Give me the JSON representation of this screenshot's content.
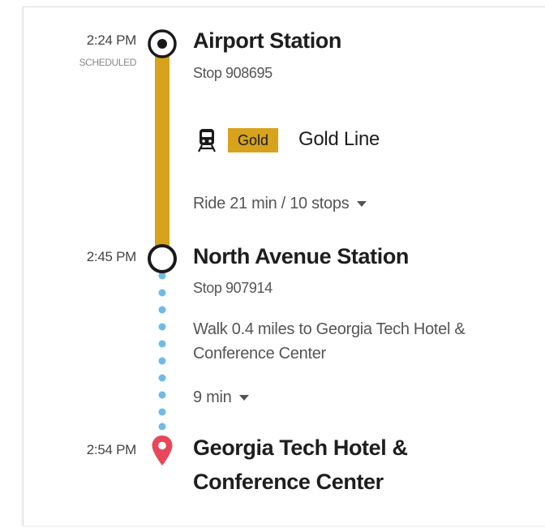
{
  "stops": [
    {
      "time": "2:24 PM",
      "status": "SCHEDULED",
      "name": "Airport Station",
      "stop_id": "Stop 908695"
    },
    {
      "time": "2:45 PM",
      "name": "North Avenue Station",
      "stop_id": "Stop 907914"
    },
    {
      "time": "2:54 PM",
      "name_line1": "Georgia Tech Hotel &",
      "name_line2": "Conference Center"
    }
  ],
  "transit": {
    "badge": "Gold",
    "line_name": "Gold Line",
    "ride": "Ride 21 min / 10 stops",
    "icon": "train-icon",
    "color": "#d7a21c"
  },
  "walk": {
    "line1": "Walk 0.4 miles to Georgia Tech Hotel &",
    "line2": "Conference Center",
    "duration": "9 min"
  },
  "colors": {
    "gold": "#d7a21c",
    "walk_dots": "#6cbbe8",
    "destination_pin": "#e8475a"
  }
}
